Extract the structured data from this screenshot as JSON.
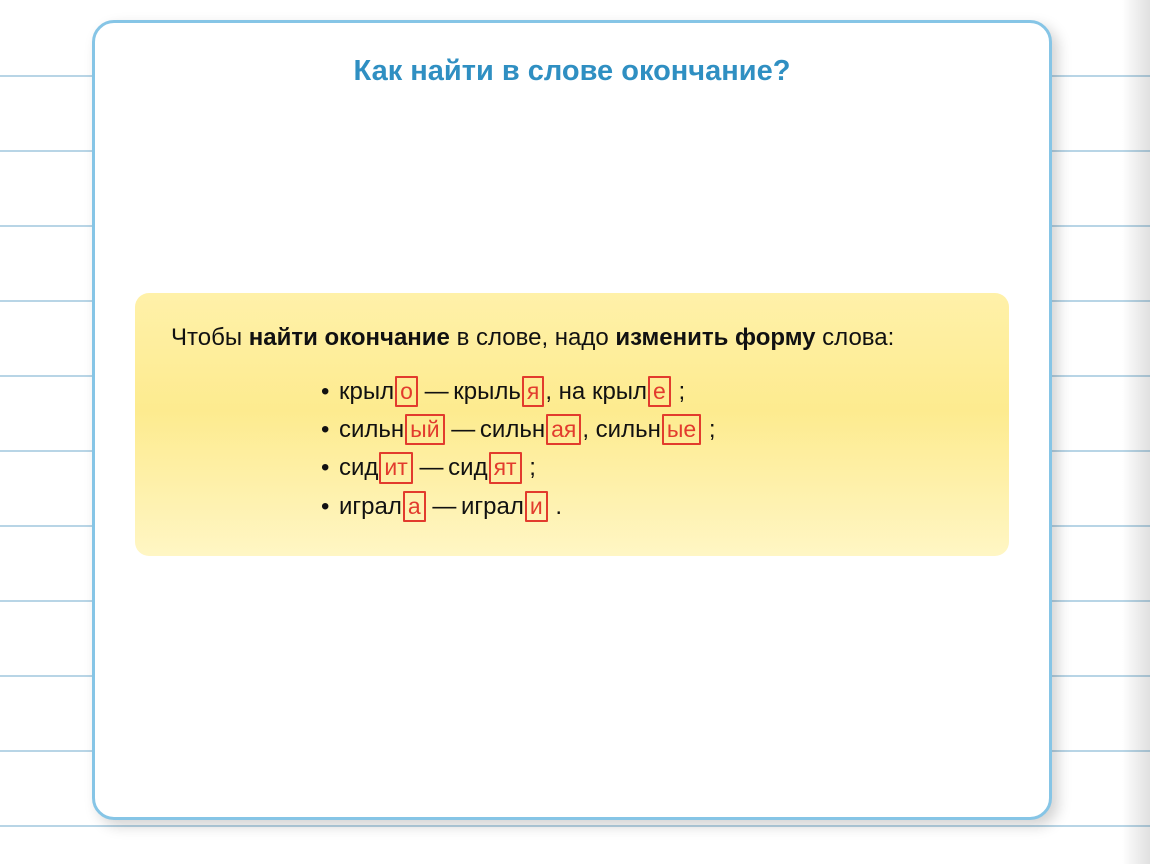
{
  "title": "Как найти в слове окончание?",
  "intro": {
    "t1": "Чтобы ",
    "b1": "найти окончание",
    "t2": " в слове, надо ",
    "b2": "изменить форму",
    "t3": " слова:"
  },
  "bullet": "•",
  "dash": "—",
  "examples": [
    {
      "parts": [
        {
          "stem": "крыл",
          "end": "о"
        },
        {
          "sep": " — "
        },
        {
          "stem": "крыль",
          "end": "я"
        },
        {
          "sep": ", на "
        },
        {
          "stem": "крыл",
          "end": "е"
        },
        {
          "sep": " ;"
        }
      ]
    },
    {
      "parts": [
        {
          "stem": "сильн",
          "end": "ый"
        },
        {
          "sep": " — "
        },
        {
          "stem": "сильн",
          "end": "ая"
        },
        {
          "sep": ", "
        },
        {
          "stem": "сильн",
          "end": "ые"
        },
        {
          "sep": " ;"
        }
      ]
    },
    {
      "parts": [
        {
          "stem": "сид",
          "end": "ит"
        },
        {
          "sep": " — "
        },
        {
          "stem": "сид",
          "end": "ят"
        },
        {
          "sep": " ;"
        }
      ]
    },
    {
      "parts": [
        {
          "stem": "играл",
          "end": "а"
        },
        {
          "sep": " — "
        },
        {
          "stem": "играл",
          "end": "и"
        },
        {
          "sep": " ."
        }
      ]
    }
  ],
  "rule_positions": [
    75,
    150,
    225,
    300,
    375,
    450,
    525,
    600,
    675,
    750,
    825
  ]
}
